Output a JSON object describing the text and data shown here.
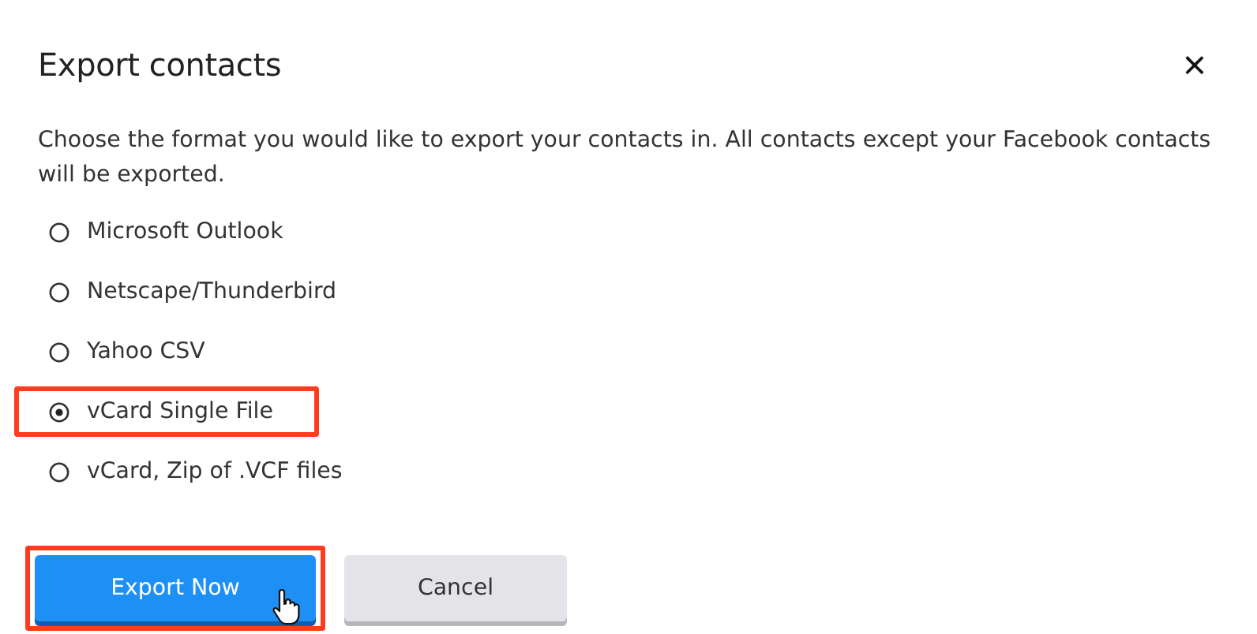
{
  "dialog": {
    "title": "Export contacts",
    "close": "×"
  },
  "description": "Choose the format you would like to export your contacts in. All contacts except your Facebook contacts will be exported.",
  "options": [
    {
      "label": "Microsoft Outlook",
      "selected": false,
      "highlighted": false
    },
    {
      "label": "Netscape/Thunderbird",
      "selected": false,
      "highlighted": false
    },
    {
      "label": "Yahoo CSV",
      "selected": false,
      "highlighted": false
    },
    {
      "label": "vCard Single File",
      "selected": true,
      "highlighted": true
    },
    {
      "label": "vCard, Zip of .VCF files",
      "selected": false,
      "highlighted": false
    }
  ],
  "buttons": [
    {
      "label": "Export Now",
      "kind": "primary",
      "highlighted": true
    },
    {
      "label": "Cancel",
      "kind": "secondary",
      "highlighted": false
    }
  ]
}
